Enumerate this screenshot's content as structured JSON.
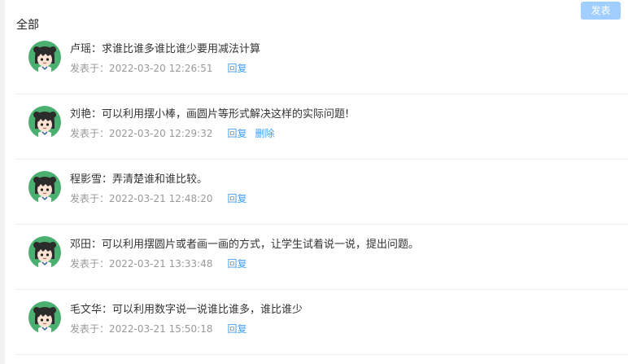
{
  "toolbar": {
    "post_label": "发表"
  },
  "section": {
    "title": "全部"
  },
  "posted_prefix": "发表于：",
  "reply_label": "回复",
  "delete_label": "删除",
  "comments": [
    {
      "author": "卢瑶",
      "text": "求谁比谁多谁比谁少要用减法计算",
      "time": "2022-03-20 12:26:51"
    },
    {
      "author": "刘艳",
      "text": "可以利用摆小棒，画圆片等形式解决这样的实际问题!",
      "time": "2022-03-20 12:29:32",
      "can_delete": true
    },
    {
      "author": "程影雪",
      "text": "弄清楚谁和谁比较。",
      "time": "2022-03-21 12:48:20"
    },
    {
      "author": "邓田",
      "text": "可以利用摆圆片或者画一画的方式，让学生试着说一说，提出问题。",
      "time": "2022-03-21 13:33:48"
    },
    {
      "author": "毛文华",
      "text": "可以利用数字说一说谁比谁多，谁比谁少",
      "time": "2022-03-21 15:50:18"
    }
  ],
  "colors": {
    "accent": "#409eff",
    "button_disabled": "#a0cfff",
    "avatar_bg": "#4caf72",
    "muted_text": "#999999"
  }
}
